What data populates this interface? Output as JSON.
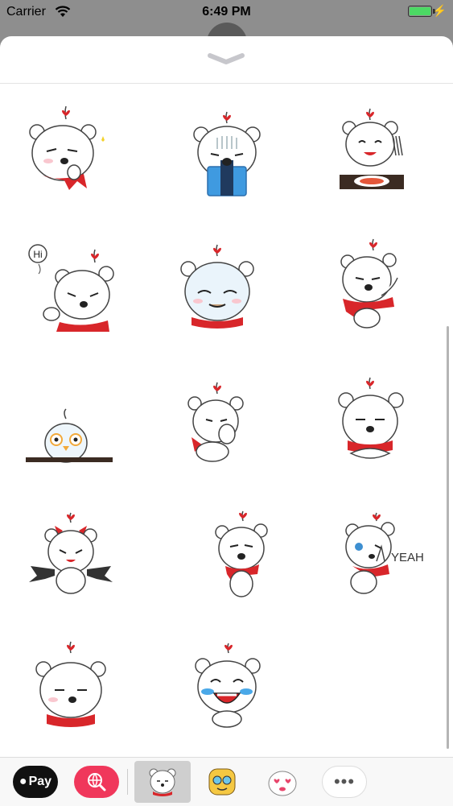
{
  "status_bar": {
    "carrier": "Carrier",
    "time": "6:49 PM"
  },
  "stickers": [
    {
      "name": "bear-thinking"
    },
    {
      "name": "bear-gift"
    },
    {
      "name": "bear-eating"
    },
    {
      "name": "bear-hi",
      "text": "Hi"
    },
    {
      "name": "bear-smirk"
    },
    {
      "name": "bear-pointing"
    },
    {
      "name": "chick-peek"
    },
    {
      "name": "bear-facepalm"
    },
    {
      "name": "bear-arms-crossed"
    },
    {
      "name": "bear-devil"
    },
    {
      "name": "bear-annoyed"
    },
    {
      "name": "bear-yeah",
      "text": "YEAH"
    },
    {
      "name": "bear-smug"
    },
    {
      "name": "bear-laugh-cry"
    }
  ],
  "toolbar": {
    "apple_pay_label": "Pay",
    "more_label": "•••"
  },
  "colors": {
    "accent_red": "#d8262a",
    "search_pink": "#f0375b",
    "battery": "#4cd964"
  }
}
